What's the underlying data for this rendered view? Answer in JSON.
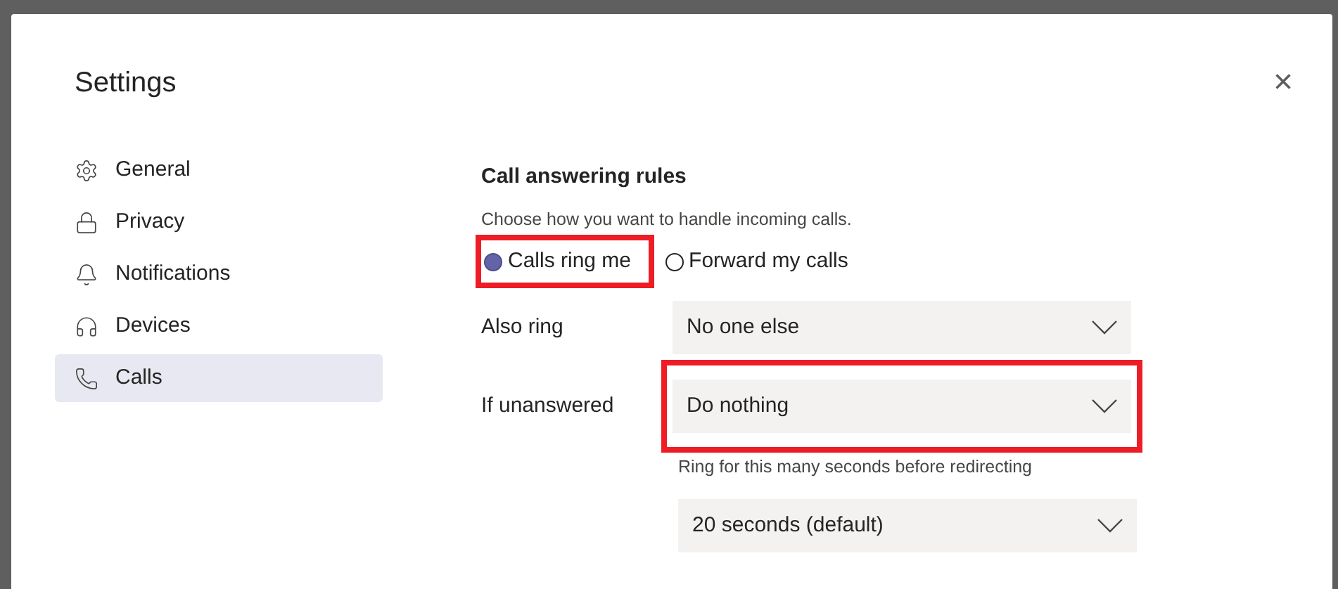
{
  "dialog": {
    "title": "Settings",
    "close": "×"
  },
  "sidebar": {
    "items": [
      {
        "kind": "gear",
        "label": "General",
        "selected": false
      },
      {
        "kind": "lock",
        "label": "Privacy",
        "selected": false
      },
      {
        "kind": "bell",
        "label": "Notifications",
        "selected": false
      },
      {
        "kind": "headset",
        "label": "Devices",
        "selected": false
      },
      {
        "kind": "phone",
        "label": "Calls",
        "selected": true
      }
    ]
  },
  "section": {
    "heading": "Call answering rules",
    "description": "Choose how you want to handle incoming calls.",
    "options": [
      {
        "label": "Calls ring me",
        "selected": true,
        "highlighted": true
      },
      {
        "label": "Forward my calls",
        "selected": false,
        "highlighted": false
      }
    ],
    "rows": [
      {
        "label": "Also ring",
        "value": "No one else",
        "highlighted": false
      },
      {
        "label": "If unanswered",
        "value": "Do nothing",
        "highlighted": true
      }
    ],
    "ring_hint": "Ring for this many seconds before redirecting",
    "ring_value": "20 seconds (default)"
  }
}
